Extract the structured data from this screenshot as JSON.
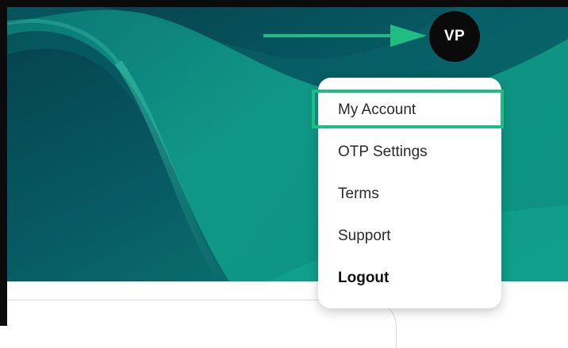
{
  "profile": {
    "avatar_initials": "VP"
  },
  "menu": {
    "items": [
      {
        "label": "My Account"
      },
      {
        "label": "OTP Settings"
      },
      {
        "label": "Terms"
      },
      {
        "label": "Support"
      },
      {
        "label": "Logout"
      }
    ]
  },
  "colors": {
    "hero_dark": "#063f4c",
    "hero_mid": "#0a6b6e",
    "hero_light": "#12a08c",
    "accent_annotation": "#1fbd83",
    "avatar_bg": "#0a0a0a"
  },
  "icons": {
    "annotation": "arrow-right-icon"
  }
}
